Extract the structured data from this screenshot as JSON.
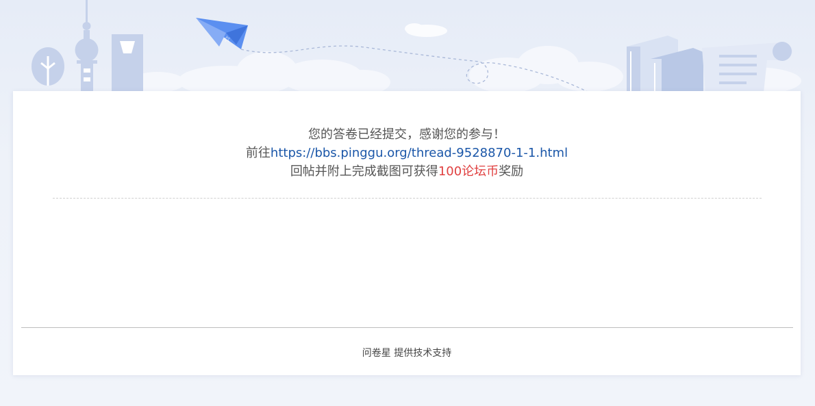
{
  "message": {
    "line1": "您的答卷已经提交，感谢您的参与！",
    "prefix": "前往",
    "link_text": "https://bbs.pinggu.org/thread-9528870-1-1.html",
    "line3_before": "回帖并附上完成截图可获得",
    "reward": "100论坛币",
    "line3_after": "奖励"
  },
  "footer": {
    "brand": "问卷星",
    "support_text": "提供技术支持"
  },
  "colors": {
    "link": "#1a56a8",
    "reward": "#e04040",
    "text": "#555555"
  }
}
